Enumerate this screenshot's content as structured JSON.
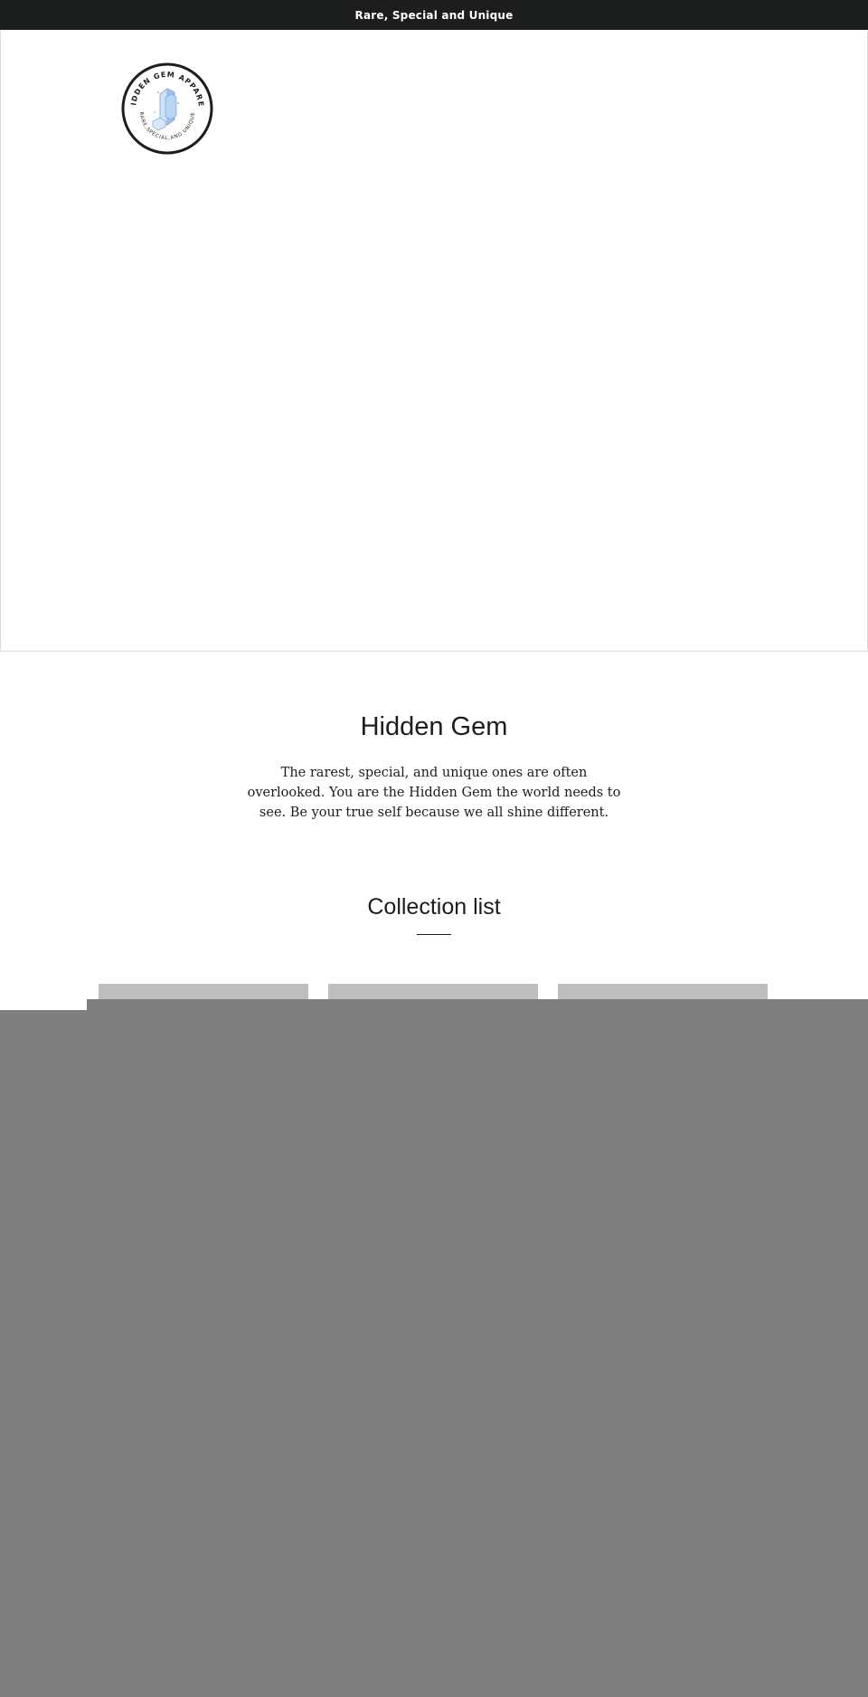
{
  "announcement": {
    "text": "Rare, Special and Unique"
  },
  "header": {
    "logo": {
      "top_text": "HIDDEN GEM APPAREL",
      "bottom_text": "RARE,SPECIAL,AND UNIQUE",
      "icon": "gem-crystal-icon",
      "ring_color": "#1c1d1d",
      "gem_color": "#9cc3ea"
    }
  },
  "intro": {
    "title": "Hidden Gem",
    "text": "The rarest, special, and unique ones are often overlooked. You are the Hidden Gem the world needs to see. Be your true self because we all shine different."
  },
  "collection": {
    "title": "Collection list",
    "placeholder_color": "#bebebe"
  },
  "overlay": {
    "color": "#7f7f7f"
  },
  "colors": {
    "announcement_bg": "#1c1d1d",
    "text": "#1c1d1d"
  }
}
